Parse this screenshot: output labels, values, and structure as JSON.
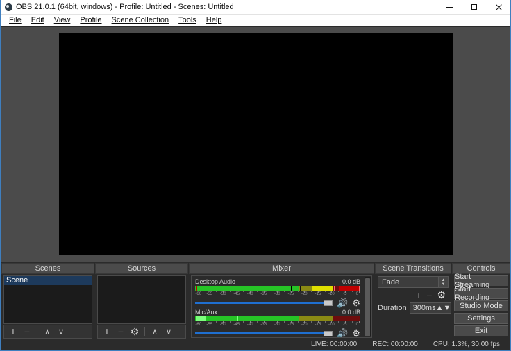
{
  "window": {
    "title": "OBS 21.0.1 (64bit, windows) - Profile: Untitled - Scenes: Untitled",
    "app_icon": "obs-logo-icon",
    "minimize": "minimize-icon",
    "maximize": "maximize-icon",
    "close": "close-icon"
  },
  "menu": {
    "items": [
      {
        "label": "File"
      },
      {
        "label": "Edit"
      },
      {
        "label": "View"
      },
      {
        "label": "Profile"
      },
      {
        "label": "Scene Collection"
      },
      {
        "label": "Tools"
      },
      {
        "label": "Help"
      }
    ]
  },
  "scenes": {
    "title": "Scenes",
    "items": [
      {
        "label": "Scene",
        "selected": true
      }
    ],
    "toolbar": {
      "add": "+",
      "remove": "−",
      "up": "∧",
      "down": "∨"
    }
  },
  "sources": {
    "title": "Sources",
    "items": [],
    "toolbar": {
      "add": "+",
      "remove": "−",
      "properties": "⚙",
      "up": "∧",
      "down": "∨"
    }
  },
  "mixer": {
    "title": "Mixer",
    "tick_labels": [
      "-60",
      "-55",
      "-50",
      "-45",
      "-40",
      "-35",
      "-30",
      "-25",
      "-20",
      "-15",
      "-10",
      "-5",
      "0"
    ],
    "channels": [
      {
        "name": "Desktop Audio",
        "level_db": "0.0 dB",
        "mute_icon": "speaker-icon",
        "settings_icon": "gear-icon",
        "volume_percent": 100,
        "meter": {
          "green_pct": 63,
          "yellow_pct": 20,
          "red_pct": 17
        }
      },
      {
        "name": "Mic/Aux",
        "level_db": "0.0 dB",
        "mute_icon": "speaker-icon",
        "settings_icon": "gear-icon",
        "volume_percent": 100,
        "meter": {
          "green_pct": 63,
          "yellow_pct": 20,
          "red_pct": 17
        }
      }
    ]
  },
  "transitions": {
    "title": "Scene Transitions",
    "selected": "Fade",
    "add": "+",
    "remove": "−",
    "properties": "⚙",
    "duration_label": "Duration",
    "duration_value": "300ms"
  },
  "controls": {
    "title": "Controls",
    "buttons": [
      {
        "label": "Start Streaming"
      },
      {
        "label": "Start Recording"
      },
      {
        "label": "Studio Mode"
      },
      {
        "label": "Settings"
      },
      {
        "label": "Exit"
      }
    ]
  },
  "status": {
    "live": "LIVE: 00:00:00",
    "rec": "REC: 00:00:00",
    "cpu": "CPU: 1.3%, 30.00 fps"
  },
  "colors": {
    "accent_blue": "#3f7fbf",
    "selection": "#1d3a5c",
    "meter_green": "#26c426",
    "meter_yellow": "#e0e000",
    "meter_red": "#c00000",
    "slider_blue": "#1f6fd0"
  }
}
